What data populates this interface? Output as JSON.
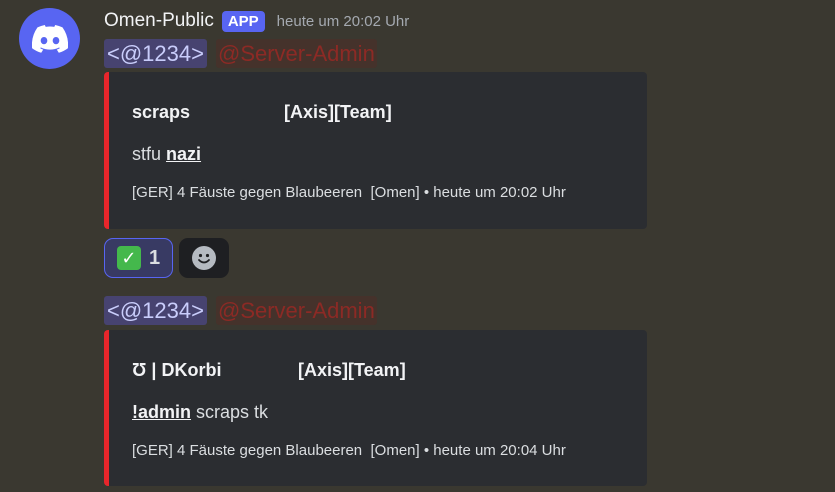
{
  "message": {
    "username": "Omen-Public",
    "badge": "APP",
    "timestamp": "heute um 20:02 Uhr"
  },
  "mentions": {
    "user": "<@1234>",
    "role": "@Server-Admin"
  },
  "embeds": [
    {
      "player": "scraps",
      "team": "[Axis][Team]",
      "body_prefix": "stfu ",
      "body_bold": "nazi",
      "body_suffix": "",
      "footer": "[GER] 4 Fäuste gegen Blaubeeren  [Omen] • heute um 20:02 Uhr",
      "accent_color": "#e8262b"
    },
    {
      "player": "Ʊ | DKorbi",
      "team": "[Axis][Team]",
      "body_prefix": "",
      "body_bold": "!admin",
      "body_suffix": " scraps tk",
      "footer": "[GER] 4 Fäuste gegen Blaubeeren  [Omen] • heute um 20:04 Uhr",
      "accent_color": "#e8262b"
    }
  ],
  "reactions": [
    {
      "emoji": "check-mark-emoji",
      "count": "1",
      "active": true
    },
    {
      "emoji": "add-reaction-icon",
      "count": "",
      "active": false
    }
  ],
  "colors": {
    "background": "#3a3830",
    "blurple": "#5865f2",
    "embed_bg": "#2b2d31",
    "role_red": "#8c2a25"
  }
}
